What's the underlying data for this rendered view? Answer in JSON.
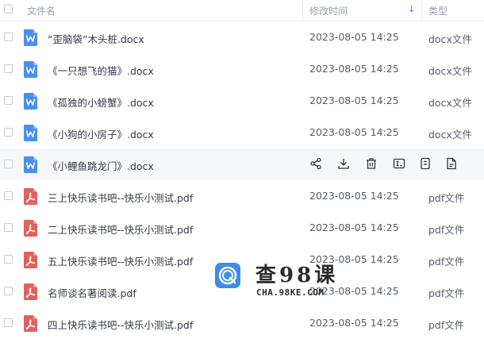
{
  "header": {
    "name_label": "文件名",
    "time_label": "修改时间",
    "type_label": "类型",
    "sort_icon": "arrow-down-icon"
  },
  "colors": {
    "word": "#4a8ff0",
    "pdf": "#e2615d",
    "accent": "#1e88f7"
  },
  "rows": [
    {
      "name": "“歪脑袋”木头桩.docx",
      "time": "2023-08-05 14:25",
      "type": "docx文件",
      "icon": "word-file-icon"
    },
    {
      "name": "《一只想飞的猫》.docx",
      "time": "2023-08-05 14:25",
      "type": "docx文件",
      "icon": "word-file-icon"
    },
    {
      "name": "《孤独的小螃蟹》.docx",
      "time": "2023-08-05 14:25",
      "type": "docx文件",
      "icon": "word-file-icon"
    },
    {
      "name": "《小狗的小房子》.docx",
      "time": "2023-08-05 14:25",
      "type": "docx文件",
      "icon": "word-file-icon"
    },
    {
      "name": "《小鲤鱼跳龙门》.docx",
      "time": "",
      "type": "",
      "icon": "word-file-icon",
      "hover": true
    },
    {
      "name": "三上快乐读书吧--快乐小测试.pdf",
      "time": "2023-08-05 14:25",
      "type": "pdf文件",
      "icon": "pdf-file-icon"
    },
    {
      "name": "二上快乐读书吧--快乐小测试.pdf",
      "time": "2023-08-05 14:25",
      "type": "pdf文件",
      "icon": "pdf-file-icon"
    },
    {
      "name": "五上快乐读书吧--快乐小测试.pdf",
      "time": "2023-08-05 14:25",
      "type": "pdf文件",
      "icon": "pdf-file-icon"
    },
    {
      "name": "名师谈名著阅读.pdf",
      "time": "2023-08-05 14:25",
      "type": "pdf文件",
      "icon": "pdf-file-icon"
    },
    {
      "name": "四上快乐读书吧--快乐小测试.pdf",
      "time": "2023-08-05 14:25",
      "type": "pdf文件",
      "icon": "pdf-file-icon"
    }
  ],
  "hover_actions": [
    "share-icon",
    "download-icon",
    "delete-icon",
    "rename-icon",
    "copy-icon",
    "file-info-icon"
  ],
  "watermark": {
    "title": "查98课",
    "url": "CHA.98KE.COM"
  }
}
